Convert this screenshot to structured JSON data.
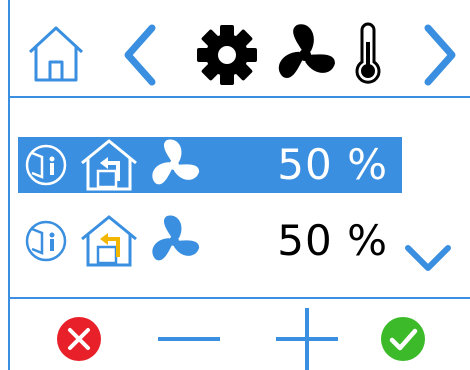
{
  "rows": [
    {
      "value": "50 %",
      "selected": true
    },
    {
      "value": "50 %",
      "selected": false
    }
  ],
  "icons": {
    "top": [
      "home-icon",
      "chevron-left-icon",
      "gear-icon",
      "fan-icon",
      "thermometer-icon",
      "chevron-right-icon"
    ],
    "row": [
      "occupancy-icon",
      "house-return-icon",
      "fan-icon"
    ],
    "bottom": [
      "cancel-icon",
      "minus-icon",
      "plus-icon",
      "confirm-icon"
    ],
    "scroll": "chevron-down-icon"
  },
  "colors": {
    "accent": "#3a8fe0",
    "cancel": "#e8202a",
    "confirm": "#3cba2a",
    "return_arrow": "#f2b600"
  }
}
